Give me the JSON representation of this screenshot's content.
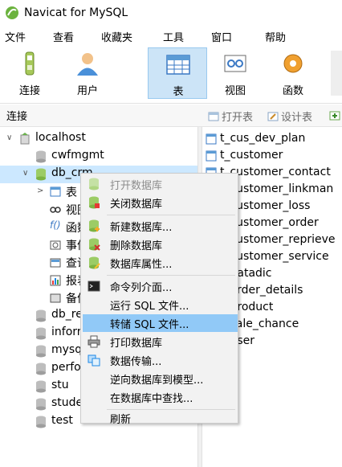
{
  "window": {
    "title": "Navicat for MySQL"
  },
  "menubar": [
    "文件",
    "查看",
    "收藏夹",
    "工具",
    "窗口",
    "帮助"
  ],
  "toolbar": {
    "buttons": [
      {
        "label": "连接",
        "icon": "connection-icon"
      },
      {
        "label": "用户",
        "icon": "user-icon"
      },
      {
        "label": "表",
        "icon": "table-icon",
        "active": true
      },
      {
        "label": "视图",
        "icon": "view-icon"
      },
      {
        "label": "函数",
        "icon": "function-icon"
      }
    ]
  },
  "connection_panel": {
    "header": "连接"
  },
  "object_toolbar": {
    "open_table": "打开表",
    "design_table": "设计表"
  },
  "tree": {
    "root": "localhost",
    "databases_before": [
      "cwfmgmt"
    ],
    "open_db": "db_crm",
    "open_db_children": [
      {
        "label": "表",
        "icon": "table-icon"
      },
      {
        "label": "视图",
        "icon": "view-icon"
      },
      {
        "label": "函数",
        "icon": "function-icon"
      },
      {
        "label": "事件",
        "icon": "event-icon"
      },
      {
        "label": "查询",
        "icon": "query-icon"
      },
      {
        "label": "报表",
        "icon": "report-icon"
      },
      {
        "label": "备份",
        "icon": "backup-icon"
      }
    ],
    "databases_after": [
      "db_re",
      "inforr",
      "mysq",
      "perfo",
      "stu",
      "stude",
      "test"
    ]
  },
  "tables": [
    "t_cus_dev_plan",
    "t_customer",
    "t_customer_contact",
    "t_customer_linkman",
    "t_customer_loss",
    "t_customer_order",
    "t_customer_reprieve",
    "t_customer_service",
    "t_datadic",
    "t_order_details",
    "t_product",
    "t_sale_chance",
    "t_user"
  ],
  "context_menu": {
    "items": [
      {
        "label": "打开数据库",
        "icon": "open-db-icon",
        "disabled": true
      },
      {
        "label": "关闭数据库",
        "icon": "close-db-icon"
      },
      {
        "sep": true
      },
      {
        "label": "新建数据库...",
        "icon": "new-db-icon"
      },
      {
        "label": "删除数据库",
        "icon": "delete-db-icon"
      },
      {
        "label": "数据库属性...",
        "icon": "db-properties-icon"
      },
      {
        "sep": true
      },
      {
        "label": "命令列介面...",
        "icon": "console-icon"
      },
      {
        "label": "运行 SQL 文件..."
      },
      {
        "label": "转储 SQL 文件...",
        "highlight": true
      },
      {
        "label": "打印数据库",
        "icon": "print-icon"
      },
      {
        "label": "数据传输...",
        "icon": "transfer-icon"
      },
      {
        "label": "逆向数据库到模型..."
      },
      {
        "label": "在数据库中查找..."
      },
      {
        "sep": true
      },
      {
        "label": "刷新"
      }
    ]
  }
}
